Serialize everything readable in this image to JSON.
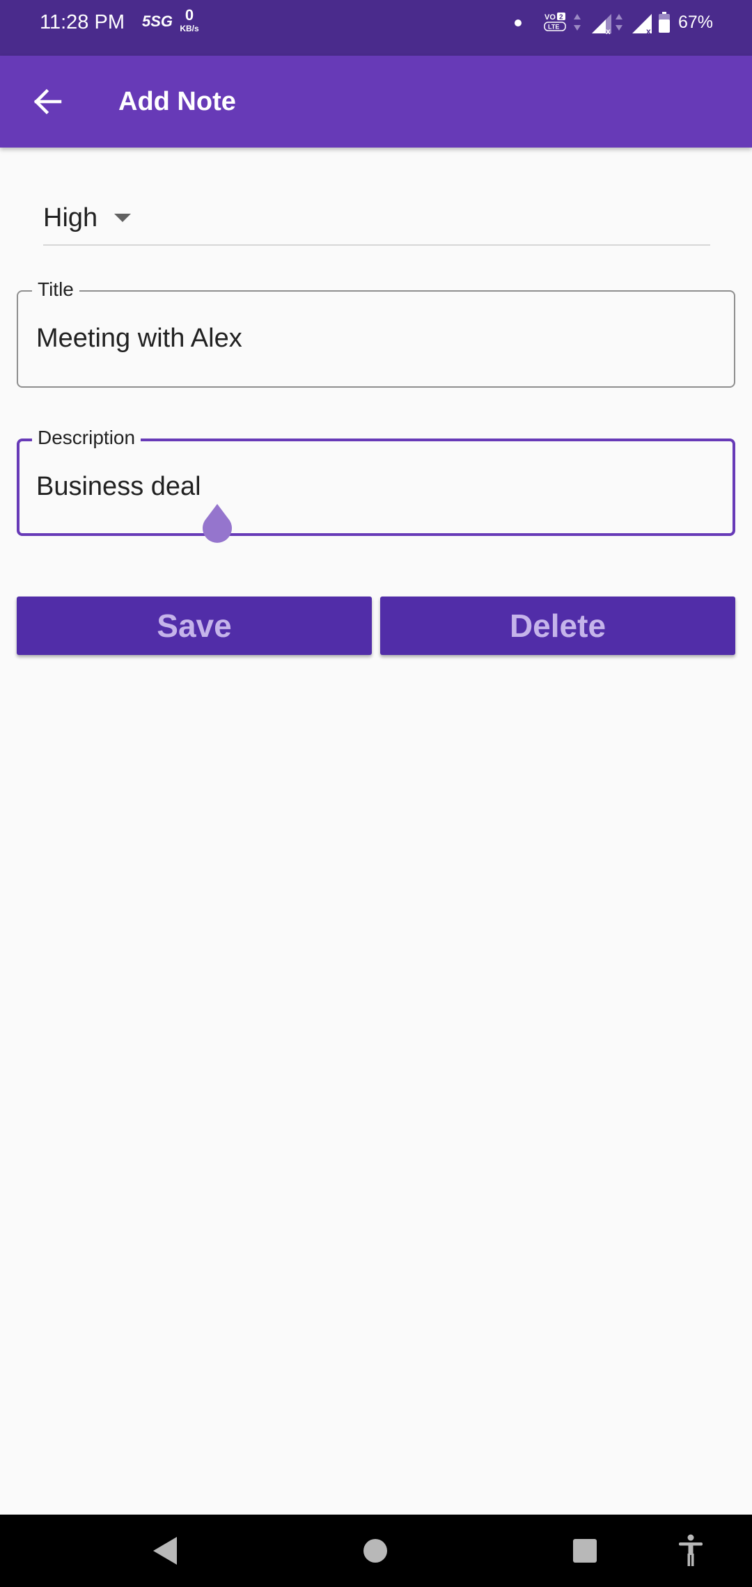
{
  "status_bar": {
    "time": "11:28 PM",
    "network_label": "5SG",
    "data_speed_value": "0",
    "data_speed_unit": "KB/s",
    "volte_label": "VO 2 LTE",
    "battery_percent": "67%"
  },
  "app_bar": {
    "title": "Add Note",
    "back_icon": "arrow-left-icon"
  },
  "form": {
    "priority": {
      "selected": "High",
      "options_visible": [
        "High"
      ]
    },
    "title_field": {
      "label": "Title",
      "value": "Meeting with Alex"
    },
    "description_field": {
      "label": "Description",
      "value": "Business deal",
      "focused": true
    }
  },
  "actions": {
    "save_label": "Save",
    "delete_label": "Delete"
  },
  "nav_bar": {
    "icons": [
      "back-triangle-icon",
      "home-circle-icon",
      "recents-square-icon",
      "accessibility-icon"
    ]
  },
  "colors": {
    "status_bar": "#4a2b8c",
    "app_bar": "#673ab7",
    "button_bg": "#512da8",
    "button_text": "#c5b4ea",
    "focus_accent": "#673ab7",
    "cursor_handle": "#9575cd",
    "background": "#fafafa"
  }
}
